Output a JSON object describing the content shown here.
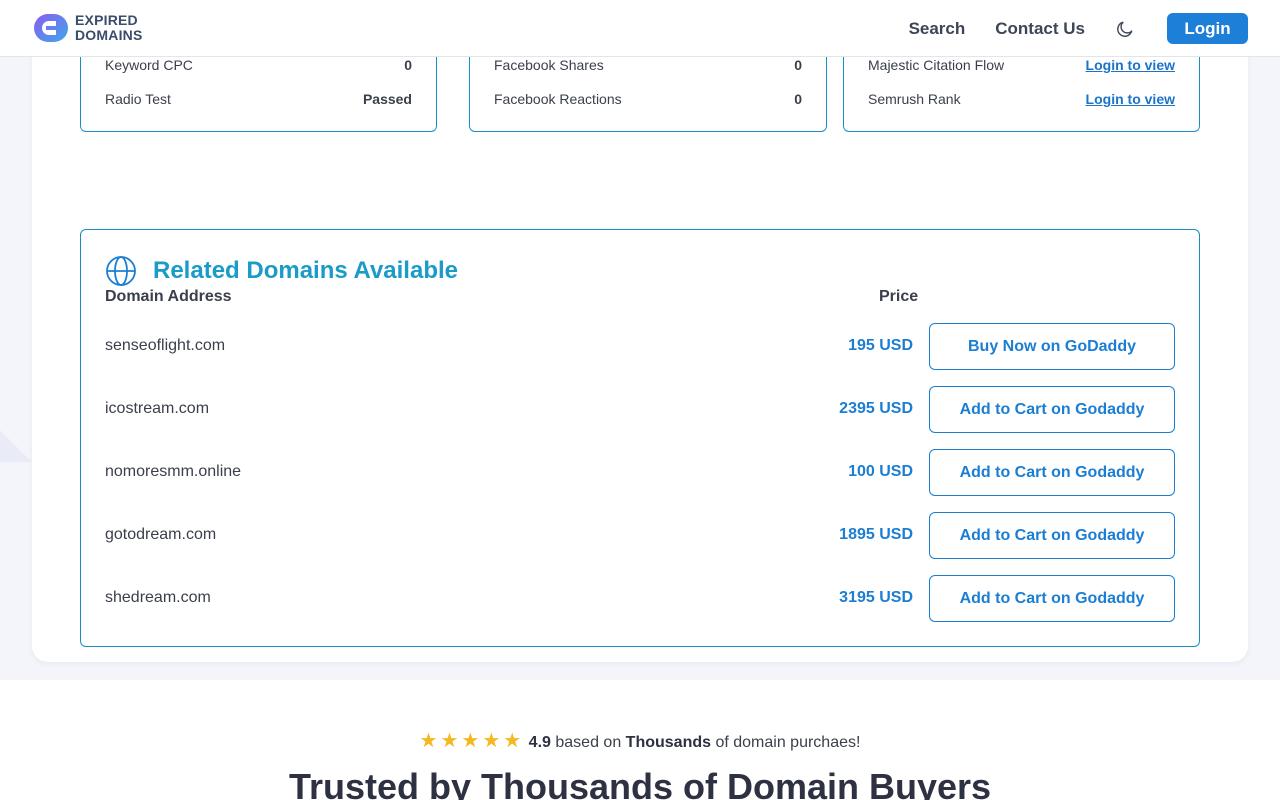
{
  "header": {
    "logo_line1": "EXPIRED",
    "logo_line2": "DOMAINS",
    "nav": {
      "search": "Search",
      "contact": "Contact Us",
      "login": "Login"
    },
    "colors": {
      "login_bg": "#1e7fd8"
    }
  },
  "stats": {
    "col1": [
      {
        "label": "Keyword CPC",
        "value": "0"
      },
      {
        "label": "Radio Test",
        "value": "Passed"
      }
    ],
    "col2": [
      {
        "label": "Facebook Shares",
        "value": "0"
      },
      {
        "label": "Facebook Reactions",
        "value": "0"
      }
    ],
    "col3": [
      {
        "label": "Majestic Citation Flow",
        "value": "Login to view"
      },
      {
        "label": "Semrush Rank",
        "value": "Login to view"
      }
    ]
  },
  "related": {
    "title": "Related Domains Available",
    "col_domain": "Domain Address",
    "col_price": "Price",
    "rows": [
      {
        "domain": "senseoflight.com",
        "price": "195 USD",
        "action": "Buy Now on GoDaddy"
      },
      {
        "domain": "icostream.com",
        "price": "2395 USD",
        "action": "Add to Cart on Godaddy"
      },
      {
        "domain": "nomoresmm.online",
        "price": "100 USD",
        "action": "Add to Cart on Godaddy"
      },
      {
        "domain": "gotodream.com",
        "price": "1895 USD",
        "action": "Add to Cart on Godaddy"
      },
      {
        "domain": "shedream.com",
        "price": "3195 USD",
        "action": "Add to Cart on Godaddy"
      }
    ]
  },
  "rating": {
    "stars": 5,
    "score": "4.9",
    "text_before": "based on",
    "highlight": "Thousands",
    "text_after": "of domain purchaes!"
  },
  "trusted_heading": "Trusted by Thousands of Domain Buyers"
}
